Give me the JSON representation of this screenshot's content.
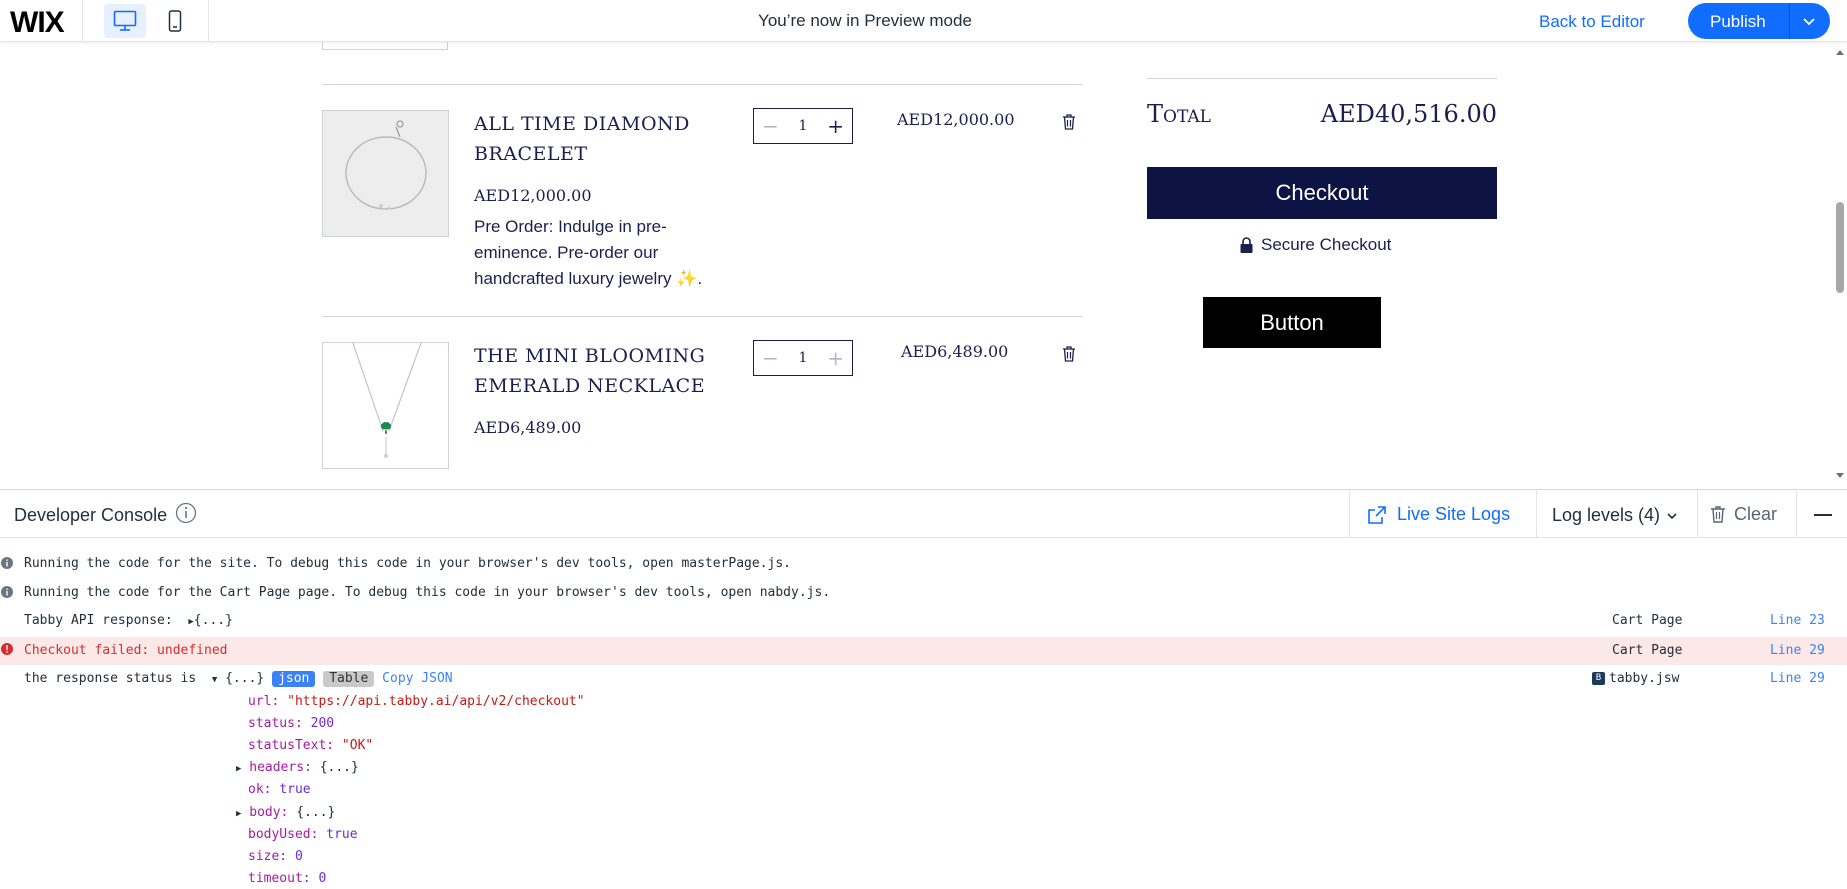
{
  "topbar": {
    "logo": "WIX",
    "preview_text": "You’re now in Preview mode",
    "back_to_editor": "Back to Editor",
    "publish": "Publish"
  },
  "cart": {
    "items": [
      {
        "name_line1": "ALL TIME DIAMOND",
        "name_line2": "BRACELET",
        "price": "AED12,000.00",
        "description": "Pre Order: Indulge in pre-eminence. Pre-order our handcrafted luxury jewelry ✨.",
        "quantity": "1",
        "line_total": "AED12,000.00"
      },
      {
        "name_line1": "THE MINI BLOOMING",
        "name_line2": "EMERALD NECKLACE",
        "price": "AED6,489.00",
        "quantity": "1",
        "line_total": "AED6,489.00"
      }
    ],
    "total_label": "Total",
    "total_value": "AED40,516.00",
    "checkout_label": "Checkout",
    "secure_checkout": "Secure Checkout",
    "button_label": "Button"
  },
  "console": {
    "title": "Developer Console",
    "live_site_logs": "Live Site Logs",
    "log_levels": "Log levels (4)",
    "clear": "Clear",
    "logs": [
      {
        "message": "Running the code for the site. To debug this code in your browser's dev tools, open masterPage.js."
      },
      {
        "message": "Running the code for the Cart Page page. To debug this code in your browser's dev tools, open nabdy.js."
      },
      {
        "message": "Tabby API response:",
        "object": "{...}",
        "source": "Cart Page",
        "line": "Line 23"
      },
      {
        "message": "Checkout failed: undefined",
        "source": "Cart Page",
        "line": "Line 29"
      },
      {
        "message": "the response status is",
        "object": "{...}",
        "tag_json": "json",
        "tag_table": "Table",
        "copy_json": "Copy JSON",
        "source": "tabby.jsw",
        "source_badge": "B",
        "line": "Line 29"
      }
    ],
    "response_props": {
      "url_key": "url:",
      "url_val": "\"https://api.tabby.ai/api/v2/checkout\"",
      "status_key": "status:",
      "status_val": "200",
      "statusText_key": "statusText:",
      "statusText_val": "\"OK\"",
      "headers_key": "headers:",
      "headers_val": "{...}",
      "ok_key": "ok:",
      "ok_val": "true",
      "body_key": "body:",
      "body_val": "{...}",
      "bodyUsed_key": "bodyUsed:",
      "bodyUsed_val": "true",
      "size_key": "size:",
      "size_val": "0",
      "timeout_key": "timeout:",
      "timeout_val": "0"
    }
  }
}
